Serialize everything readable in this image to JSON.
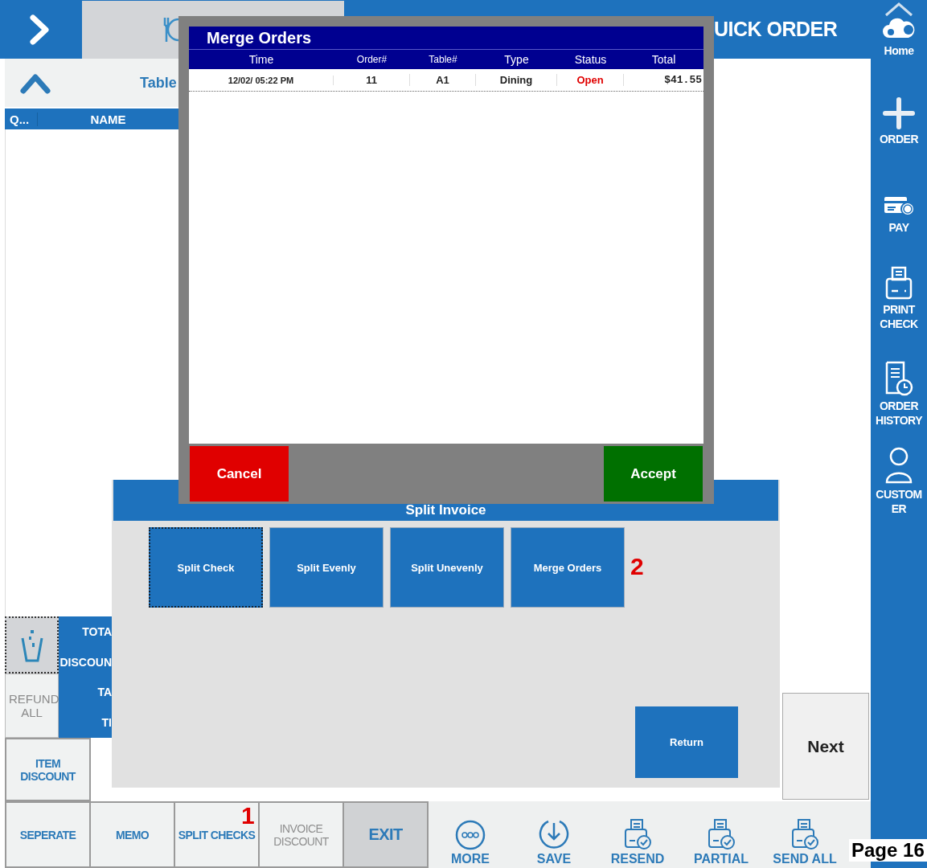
{
  "topbar": {
    "title": "UICK ORDER"
  },
  "order_panel": {
    "heading": "Table",
    "columns": [
      "Q...",
      "NAME"
    ]
  },
  "totals_labels": [
    "TOTA",
    "DISCOUN",
    "TA",
    "TI"
  ],
  "refund_button": {
    "label": "REFUND ALL",
    "disabled": true
  },
  "item_discount_button": "ITEM DISCOUNT",
  "action_buttons": [
    {
      "label": "SEPERATE",
      "disabled": false,
      "selected": false
    },
    {
      "label": "MEMO",
      "disabled": false,
      "selected": false
    },
    {
      "label": "SPLIT CHECKS",
      "disabled": false,
      "selected": false
    },
    {
      "label": "INVOICE DISCOUNT",
      "disabled": true,
      "selected": false
    },
    {
      "label": "EXIT",
      "disabled": false,
      "selected": true
    }
  ],
  "toolbar": [
    {
      "label": "MORE",
      "kind": "more"
    },
    {
      "label": "SAVE",
      "kind": "save"
    },
    {
      "label": "RESEND",
      "kind": "print"
    },
    {
      "label": "PARTIAL",
      "kind": "print"
    },
    {
      "label": "SEND ALL",
      "kind": "print"
    }
  ],
  "next_button": "Next",
  "sidebar": [
    {
      "label": "Home",
      "kind": "home"
    },
    {
      "label": "ORDER",
      "kind": "plus"
    },
    {
      "label": "PAY",
      "kind": "pay"
    },
    {
      "label": "PRINT CHECK",
      "kind": "printer"
    },
    {
      "label": "ORDER HISTORY",
      "kind": "history"
    },
    {
      "label": "CUSTOMER",
      "kind": "person"
    }
  ],
  "split_dialog": {
    "title": "Split Invoice",
    "options": [
      {
        "label": "Split Check",
        "selected": true
      },
      {
        "label": "Split Evenly",
        "selected": false
      },
      {
        "label": "Split Unevenly",
        "selected": false
      },
      {
        "label": "Merge Orders",
        "selected": false
      }
    ],
    "return_button": "Return"
  },
  "merge_dialog": {
    "title": "Merge Orders",
    "columns": [
      "Time",
      "Order#",
      "Table#",
      "Type",
      "Status",
      "Total"
    ],
    "rows": [
      {
        "time": "12/02/ 05:22 PM",
        "order": "11",
        "table": "A1",
        "type": "Dining",
        "status": "Open",
        "total": "$41.55"
      }
    ],
    "cancel_button": "Cancel",
    "accept_button": "Accept"
  },
  "annotations": [
    "1",
    "2"
  ],
  "page_label": "Page 16"
}
